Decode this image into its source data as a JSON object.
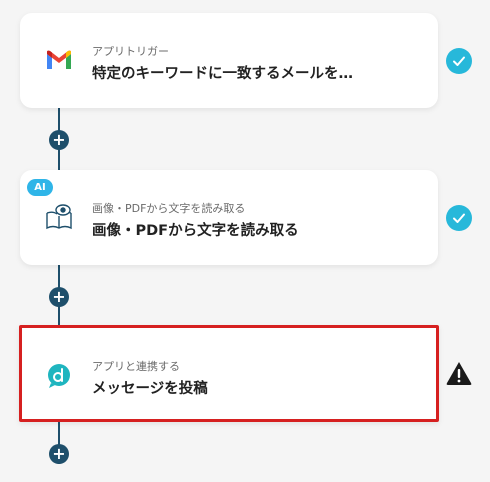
{
  "steps": [
    {
      "app": "Gmail",
      "icon": "gmail-icon",
      "subtitle": "アプリトリガー",
      "title": "特定のキーワードに一致するメールを…",
      "status": "complete"
    },
    {
      "app": "OCR",
      "icon": "book-eye-icon",
      "badge": "AI",
      "subtitle": "画像・PDFから文字を読み取る",
      "title": "画像・PDFから文字を読み取る",
      "status": "complete"
    },
    {
      "app": "Chat",
      "icon": "chat-d-logo-icon",
      "subtitle": "アプリと連携する",
      "title": "メッセージを投稿",
      "status": "warning"
    }
  ],
  "add_step_label": "+",
  "colors": {
    "connector": "#1e4f6b",
    "check": "#27b8da",
    "selected_border": "#d62020",
    "ai_badge": "#2fb5e8"
  }
}
